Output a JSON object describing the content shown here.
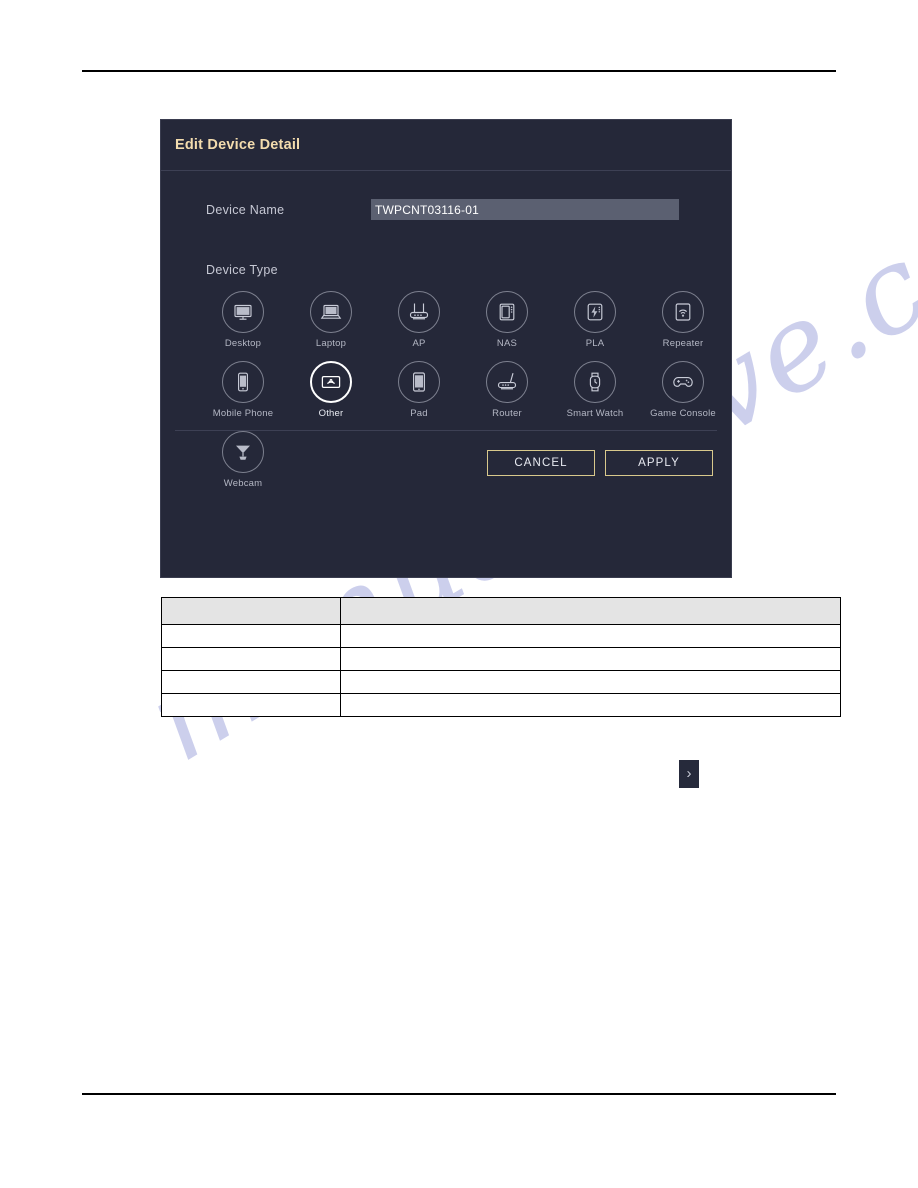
{
  "page": {
    "watermark": "manualshive.com"
  },
  "dialog": {
    "title": "Edit Device Detail",
    "device_name": {
      "label": "Device Name",
      "value": "TWPCNT03116-01",
      "placeholder": "Device Name"
    },
    "device_type": {
      "label": "Device Type",
      "selected": "Other",
      "options": [
        {
          "label": "Desktop",
          "icon": "desktop-icon"
        },
        {
          "label": "Laptop",
          "icon": "laptop-icon"
        },
        {
          "label": "AP",
          "icon": "access-point-icon"
        },
        {
          "label": "NAS",
          "icon": "nas-icon"
        },
        {
          "label": "PLA",
          "icon": "powerline-adapter-icon"
        },
        {
          "label": "Repeater",
          "icon": "repeater-icon"
        },
        {
          "label": "Mobile Phone",
          "icon": "mobile-phone-icon"
        },
        {
          "label": "Other",
          "icon": "other-device-icon"
        },
        {
          "label": "Pad",
          "icon": "tablet-icon"
        },
        {
          "label": "Router",
          "icon": "router-icon"
        },
        {
          "label": "Smart Watch",
          "icon": "smart-watch-icon"
        },
        {
          "label": "Game Console",
          "icon": "game-console-icon"
        },
        {
          "label": "Webcam",
          "icon": "webcam-icon"
        }
      ]
    },
    "buttons": {
      "cancel": "CANCEL",
      "apply": "APPLY"
    },
    "colors": {
      "background": "#252839",
      "title": "#f3dcae",
      "button_border": "#d8c98c",
      "input_background": "#5b6071",
      "selected_ring": "#ffffff"
    }
  },
  "table": {
    "header": [
      "",
      ""
    ],
    "rows": [
      [
        "",
        ""
      ],
      [
        "",
        ""
      ],
      [
        "",
        ""
      ],
      [
        "",
        ""
      ]
    ]
  },
  "chevron_button": {
    "glyph": "›",
    "name": "next-arrow"
  }
}
